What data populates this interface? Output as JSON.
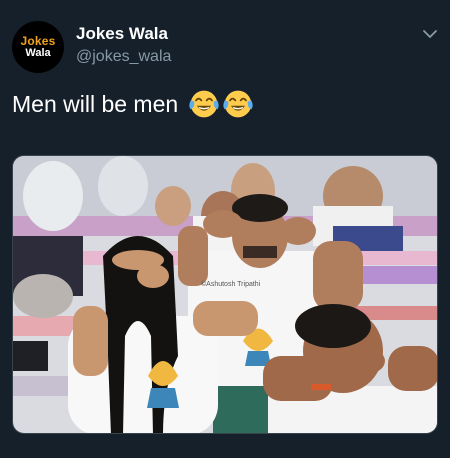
{
  "account": {
    "avatar_text_top": "Jokes",
    "avatar_text_bottom": "Wala",
    "display_name": "Jokes Wala",
    "handle": "@jokes_wala"
  },
  "tweet": {
    "text": "Men will be men",
    "emoji": [
      "face-with-tears-of-joy",
      "face-with-tears-of-joy"
    ]
  },
  "media": {
    "watermark": "©Ashutosh Tripathi"
  },
  "colors": {
    "background": "#15202b",
    "secondary_text": "#8899a6",
    "avatar_brand": "#f0a21a"
  }
}
